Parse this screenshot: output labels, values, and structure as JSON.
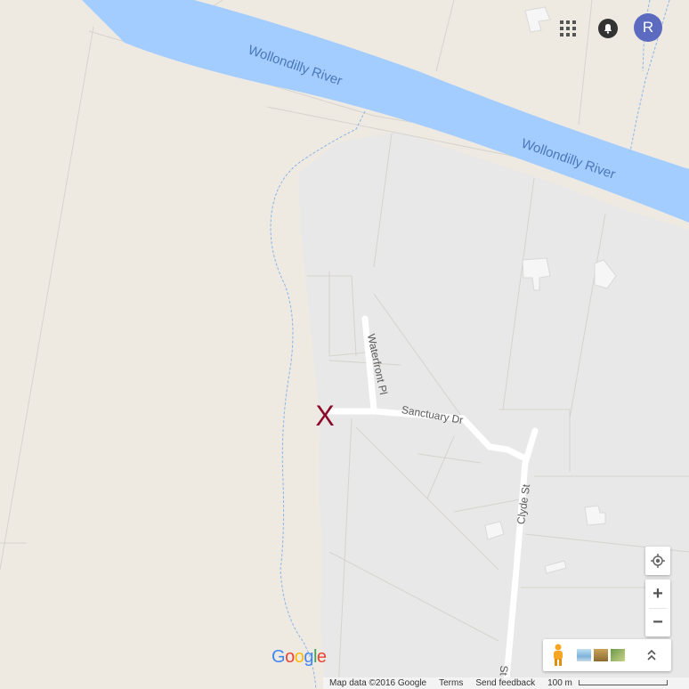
{
  "map": {
    "labels": {
      "river_1": "Wollondilly River",
      "river_2": "Wollondilly River",
      "street_waterfront": "Waterfront Pl",
      "street_sanctuary": "Sanctuary Dr",
      "street_clyde": "Clyde St",
      "street_clyde_lower": "St"
    },
    "marker": "X",
    "colors": {
      "land": "#eeeae2",
      "urban": "#e8e8e8",
      "water": "#a3ccff",
      "road": "#ffffff",
      "marker": "#8b0a2a",
      "label": "#5a5a5a",
      "water_label": "#4a78b8"
    }
  },
  "topbar": {
    "apps_icon": "apps-grid-icon",
    "notifications_icon": "notifications-icon",
    "account_initial": "R"
  },
  "controls": {
    "locate_icon": "my-location-icon",
    "zoom_in": "+",
    "zoom_out": "−",
    "pegman_icon": "pegman-icon",
    "imagery_icon": "imagery-thumbnails-icon",
    "expand_icon": "expand-chevrons-icon"
  },
  "footer": {
    "map_data": "Map data ©2016 Google",
    "terms": "Terms",
    "feedback": "Send feedback",
    "scale": "100 m"
  },
  "logo": {
    "text": "Google"
  }
}
